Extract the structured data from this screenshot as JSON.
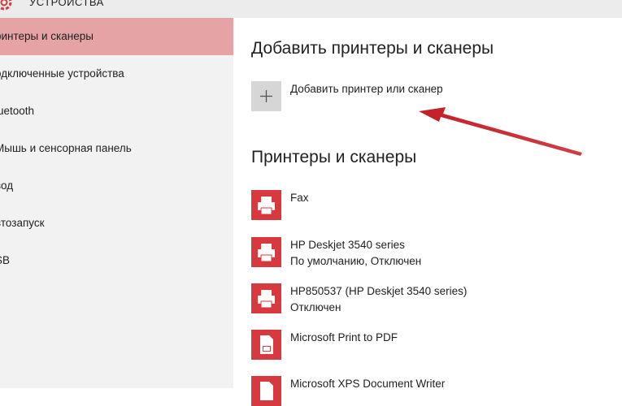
{
  "header": {
    "title": "УСТРОЙСТВА",
    "icon": "gear-icon"
  },
  "sidebar": {
    "items": [
      {
        "label": "ринтеры и сканеры",
        "active": true
      },
      {
        "label": "одключенные устройства",
        "active": false
      },
      {
        "label": "luetooth",
        "active": false
      },
      {
        "label": "Мышь и сенсорная панель",
        "active": false
      },
      {
        "label": "вод",
        "active": false
      },
      {
        "label": "втозапуск",
        "active": false
      },
      {
        "label": "SB",
        "active": false
      }
    ],
    "active_color": "#e6a3a6"
  },
  "main": {
    "add_section_title": "Добавить принтеры и сканеры",
    "add_button_label": "Добавить принтер или сканер",
    "add_icon": "plus-icon",
    "printers_section_title": "Принтеры и сканеры",
    "devices": [
      {
        "name": "Fax",
        "status": "",
        "icon": "printer-icon"
      },
      {
        "name": "HP Deskjet 3540 series",
        "status": "По умолчанию, Отключен",
        "icon": "printer-icon"
      },
      {
        "name": "HP850537 (HP Deskjet 3540 series)",
        "status": "Отключен",
        "icon": "printer-icon"
      },
      {
        "name": "Microsoft Print to PDF",
        "status": "",
        "icon": "pdf-printer-icon"
      },
      {
        "name": "Microsoft XPS Document Writer",
        "status": "",
        "icon": "xps-printer-icon"
      }
    ],
    "icon_color": "#d8393f"
  },
  "annotation": {
    "arrow_color": "#c41e25",
    "icon": "arrow-annotation-icon"
  }
}
